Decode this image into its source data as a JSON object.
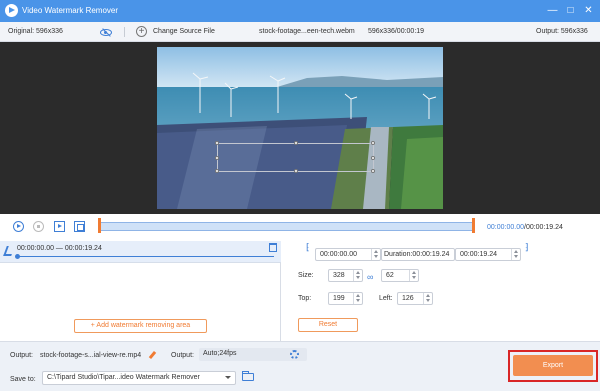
{
  "titlebar": {
    "title": "Video Watermark Remover",
    "minimize": "—",
    "maximize": "□",
    "close": "✕"
  },
  "infobar": {
    "original": "Original: 596x336",
    "change_source": "Change Source File",
    "file_name": "stock-footage...een-tech.webm",
    "file_meta": "596x336/00:00:19",
    "output": "Output: 596x336"
  },
  "playback": {
    "current_time": "00:00:00.00",
    "total_time": "00:00:19.24"
  },
  "segment": {
    "range": "00:00:00.00 — 00:00:19.24"
  },
  "left_panel": {
    "add_area": "+ Add watermark removing area"
  },
  "right_panel": {
    "start_time": "00:00:00.00",
    "duration": "Duration:00:00:19.24",
    "end_time": "00:00:19.24",
    "size_label": "Size:",
    "width": "328",
    "height": "62",
    "top_label": "Top:",
    "top": "199",
    "left_label": "Left:",
    "left": "126",
    "reset": "Reset"
  },
  "bottombar": {
    "output_label": "Output:",
    "output_file": "stock-footage-s...ial-view-re.mp4",
    "output_label_2": "Output:",
    "output_format": "Auto;24fps",
    "save_to_label": "Save to:",
    "save_path": "C:\\Tipard Studio\\Tipar...ideo Watermark Remover",
    "export": "Export"
  },
  "colors": {
    "title_bar": "#4a94e8",
    "accent": "#3f7fd6",
    "orange": "#f07b32",
    "export_button": "#f28e50",
    "highlight": "#d92626"
  }
}
